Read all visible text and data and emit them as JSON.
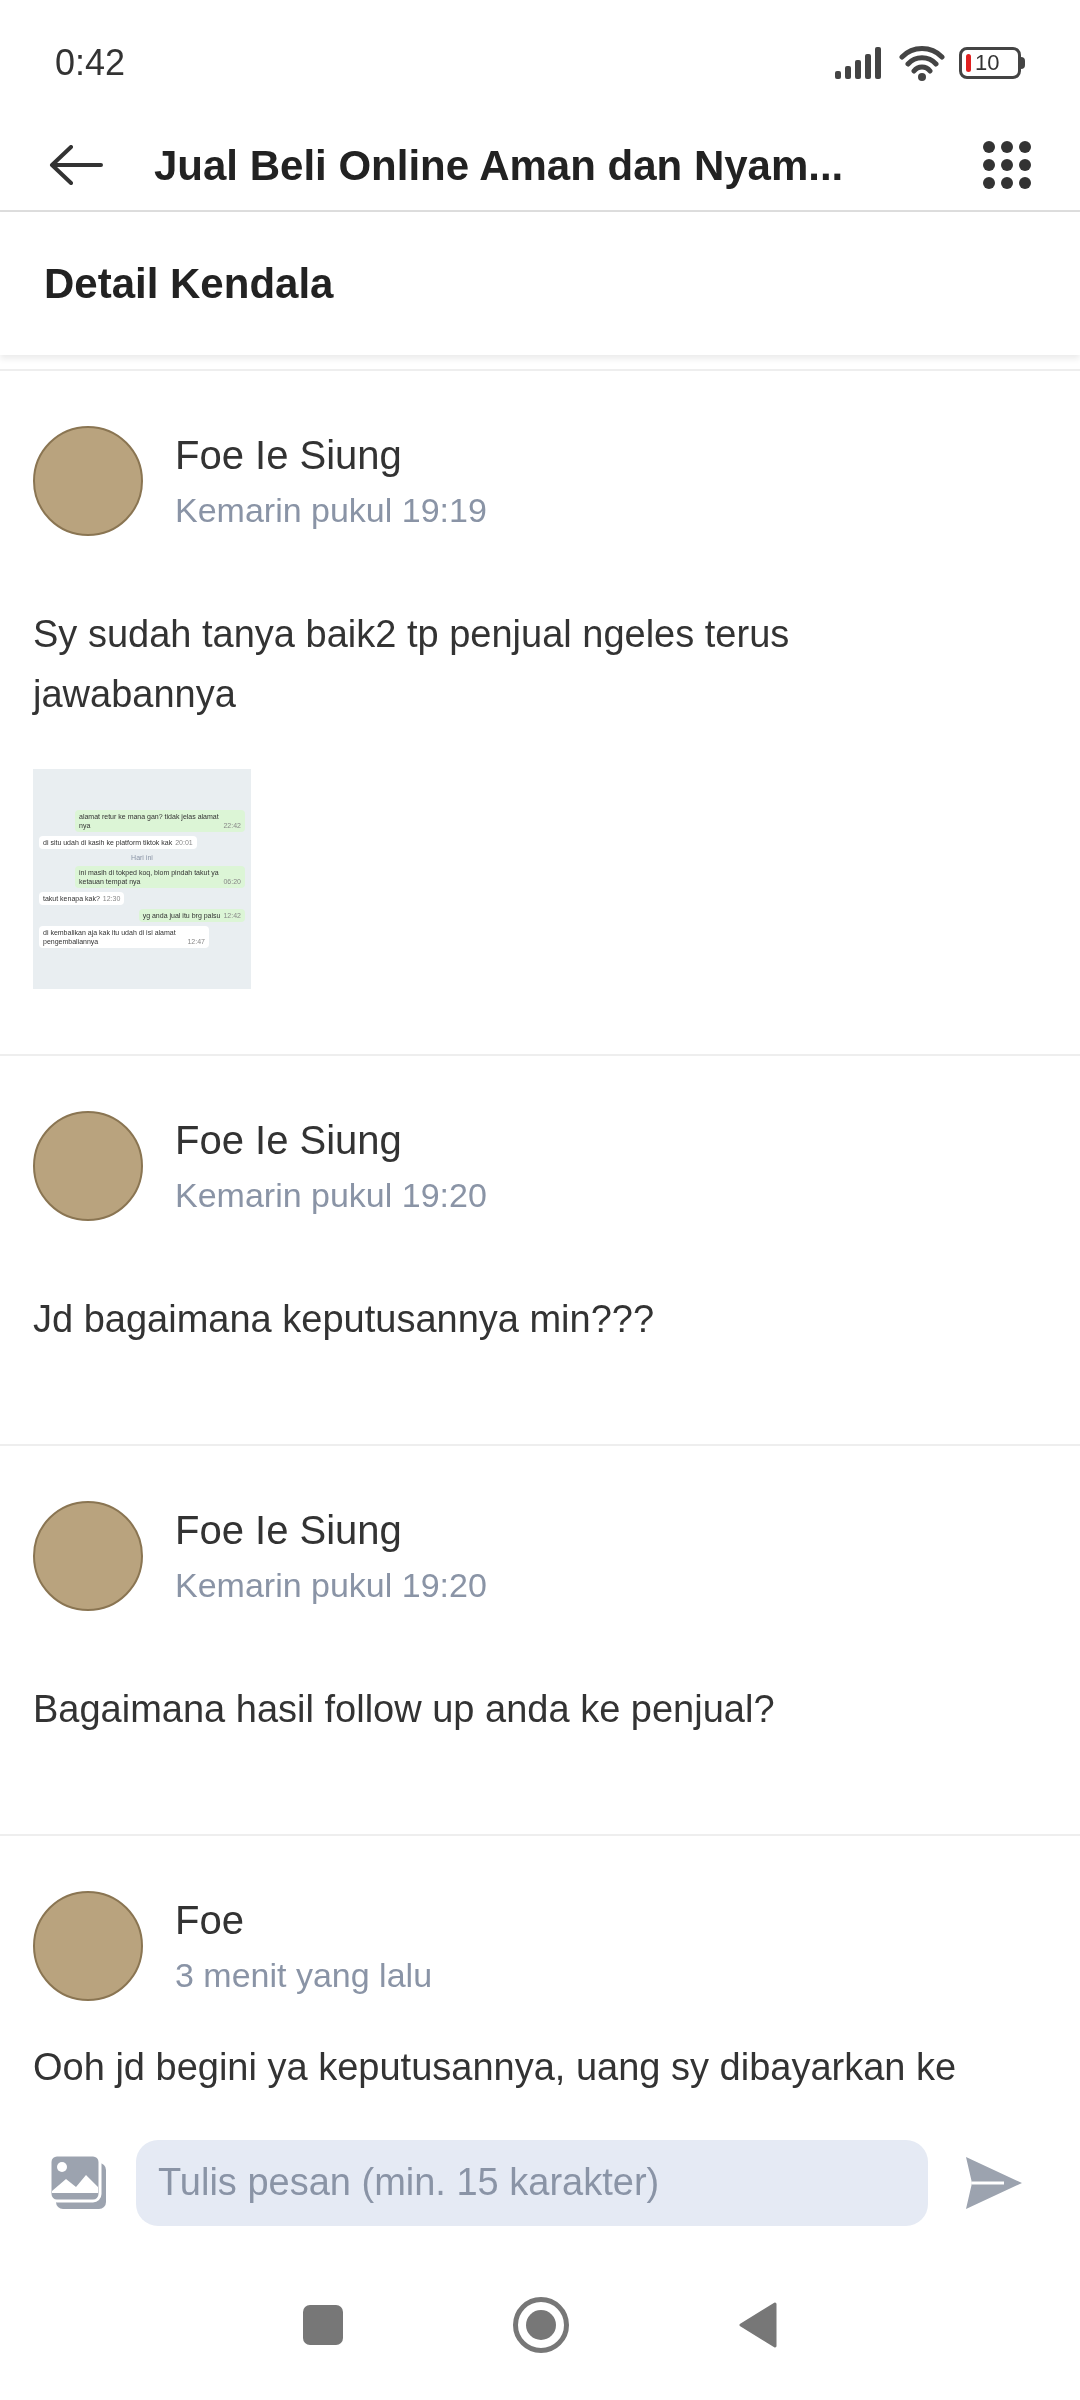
{
  "status_bar": {
    "time": "0:42",
    "battery": "10"
  },
  "app_bar": {
    "title": "Jual Beli Online Aman dan Nyam..."
  },
  "section_title": "Detail Kendala",
  "messages": [
    {
      "author": "Foe Ie Siung",
      "time": "Kemarin pukul 19:19",
      "text": "Sy sudah tanya baik2 tp penjual ngeles terus jawabannya",
      "attachment": {
        "kind": "chat_screenshot",
        "items": [
          {
            "kind": "bubble",
            "outgoing": true,
            "text": "alamat retur ke mana gan? tidak jelas alamat nya",
            "time": "22:42"
          },
          {
            "kind": "bubble",
            "outgoing": false,
            "text": "di situ udah di kasih ke platform tiktok kak",
            "time": "20:01"
          },
          {
            "kind": "date",
            "text": "Hari ini"
          },
          {
            "kind": "bubble",
            "outgoing": true,
            "text": "ini masih di tokped koq, blom pindah takut ya ketauan tempat nya",
            "time": "06:20"
          },
          {
            "kind": "bubble",
            "outgoing": false,
            "text": "takut kenapa kak?",
            "time": "12:30"
          },
          {
            "kind": "bubble",
            "outgoing": true,
            "text": "yg anda jual itu brg palsu",
            "time": "12:42"
          },
          {
            "kind": "bubble",
            "outgoing": false,
            "text": "di kembalikan aja kak itu udah di isi alamat pengembaliannya",
            "time": "12:47"
          }
        ]
      }
    },
    {
      "author": "Foe Ie Siung",
      "time": "Kemarin pukul 19:20",
      "text": "Jd bagaimana keputusannya min???"
    },
    {
      "author": "Foe Ie Siung",
      "time": "Kemarin pukul 19:20",
      "text": "Bagaimana hasil follow up anda ke penjual?"
    },
    {
      "author": "Foe",
      "time": "3 menit yang lalu",
      "text": "Ooh jd begini ya keputusannya, uang sy dibayarkan ke"
    }
  ],
  "composer": {
    "placeholder": "Tulis pesan (min. 15 karakter)"
  }
}
